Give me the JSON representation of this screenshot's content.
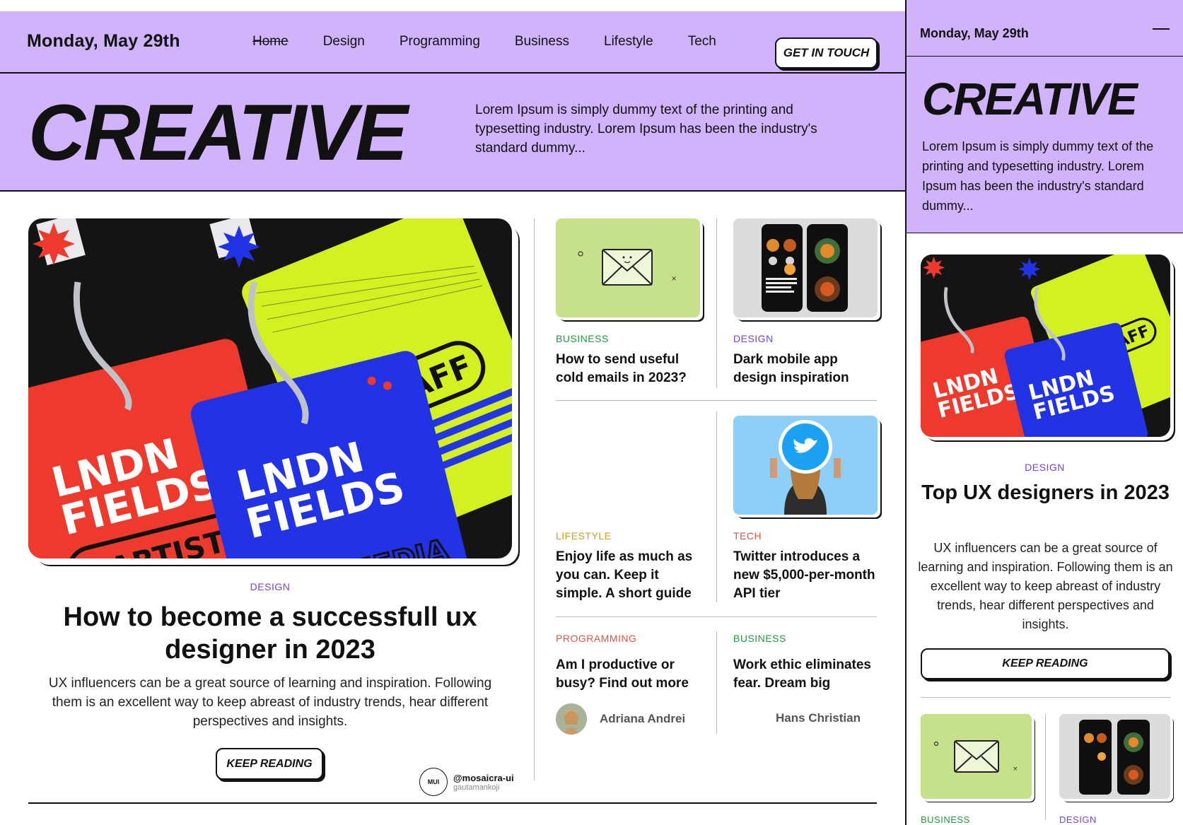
{
  "desktop": {
    "date": "Monday, May 29th",
    "nav": [
      "Home",
      "Design",
      "Programming",
      "Business",
      "Lifestyle",
      "Tech"
    ],
    "contact_button": "GET IN TOUCH",
    "hero": {
      "title": "CREATIVE",
      "description": "Lorem Ipsum is simply dummy text of the printing and typesetting industry. Lorem Ipsum has been the industry's standard dummy..."
    },
    "feature": {
      "category": "DESIGN",
      "title": "How to become a successfull ux designer in 2023",
      "description": "UX influencers can be a great source of learning and inspiration. Following them is an excellent way to keep abreast of industry trends, hear different perspectives and insights.",
      "button": "KEEP READING",
      "image_text": [
        "LNDN",
        "FIELDS",
        "STAFF",
        "ARTIST",
        "MEDIA"
      ]
    },
    "credit": {
      "handle": "@mosaicra-ui",
      "sub": "gautamankoji",
      "logo": "MUI"
    },
    "posts": [
      {
        "category": "BUSINESS",
        "color": "#1f9a3c",
        "title": "How to send useful cold emails in 2023?"
      },
      {
        "category": "DESIGN",
        "color": "#7b3fe0",
        "title": "Dark mobile app design inspiration"
      },
      {
        "category": "LIFESTYLE",
        "color": "#c7a21a",
        "title": "Enjoy life as much as you can. Keep it simple. A short guide"
      },
      {
        "category": "TECH",
        "color": "#e0553f",
        "title": "Twitter introduces a new $5,000-per-month API tier"
      },
      {
        "category": "PROGRAMMING",
        "color": "#e0553f",
        "title": "Am I productive or busy? Find out more",
        "author": "Adriana Andrei"
      },
      {
        "category": "BUSINESS",
        "color": "#1f9a3c",
        "title": "Work ethic eliminates fear. Dream big",
        "author": "Hans Christian"
      }
    ]
  },
  "mobile": {
    "date": "Monday, May 29th",
    "hero_title": "CREATIVE",
    "hero_description": "Lorem Ipsum is simply dummy text of the printing and typesetting industry. Lorem Ipsum has been the industry's standard dummy...",
    "feature": {
      "category": "DESIGN",
      "title": "Top UX designers in 2023",
      "description": "UX influencers can be a great source of learning and inspiration. Following them is an excellent way to keep abreast of industry trends, hear different perspectives and insights.",
      "button": "KEEP READING"
    },
    "cards": [
      {
        "category": "BUSINESS",
        "color": "#1f9a3c"
      },
      {
        "category": "DESIGN",
        "color": "#7b3fe0"
      }
    ]
  },
  "colors": {
    "lavender": "#d0b3fb",
    "lime": "#c7e08a",
    "sky": "#8ecff7",
    "grey": "#dcdcdc"
  }
}
